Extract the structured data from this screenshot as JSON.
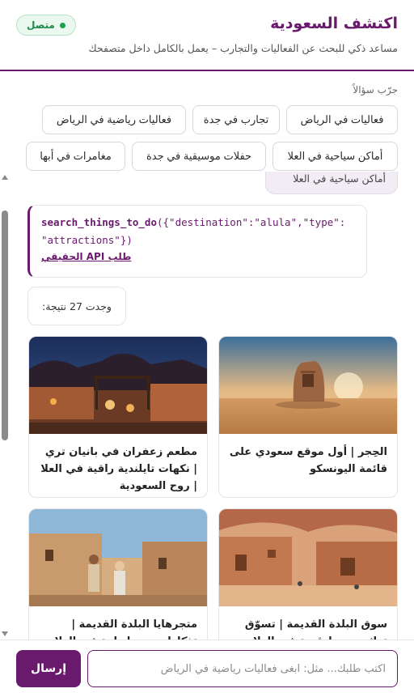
{
  "header": {
    "title": "اكتشف السعودية",
    "subtitle": "مساعد ذكي للبحث عن الفعاليات والتجارب – يعمل بالكامل داخل متصفحك",
    "status_label": "متصل",
    "brand_color": "#6a1a6d",
    "status_color": "#1e9e4f"
  },
  "suggestions": {
    "label": "جرّب سؤالاً",
    "items": [
      "فعاليات في الرياض",
      "تجارب في جدة",
      "فعاليات رياضية في الرياض",
      "أماكن سياحية في العلا",
      "حفلات موسيقية في جدة",
      "مغامرات في أبها"
    ]
  },
  "chat": {
    "user_message": "أماكن سياحية في العلا",
    "tool_call": {
      "function": "search_things_to_do",
      "args_line1": "({\"destination\":\"alula\",\"type\":",
      "args_line2": "\"attractions\"})",
      "api_label": "طلب API الحقيقي"
    },
    "result_text": "وجدت 27 نتيجة:",
    "cards": [
      {
        "title": "الحِجر | أول موقع سعودي على قائمة اليونسكو",
        "image": "desert-rock-tomb"
      },
      {
        "title": "مطعم زعفران في بانيان تري | نكهات تايلندية راقية في العلا | روح السعودية",
        "image": "restaurant-courtyard-night"
      },
      {
        "title": "سوق البلدة القديمة | تسوّق تراثي وسط قرية في العلا ...",
        "image": "old-town-market"
      },
      {
        "title": "متجرهايا البلدة القديمة | تذكارات وسط بلدة في العلا ...",
        "image": "old-town-visitors"
      }
    ]
  },
  "composer": {
    "placeholder": "اكتب طلبك... مثل: ابغى فعاليات رياضية في الرياض",
    "send_label": "إرسال"
  }
}
